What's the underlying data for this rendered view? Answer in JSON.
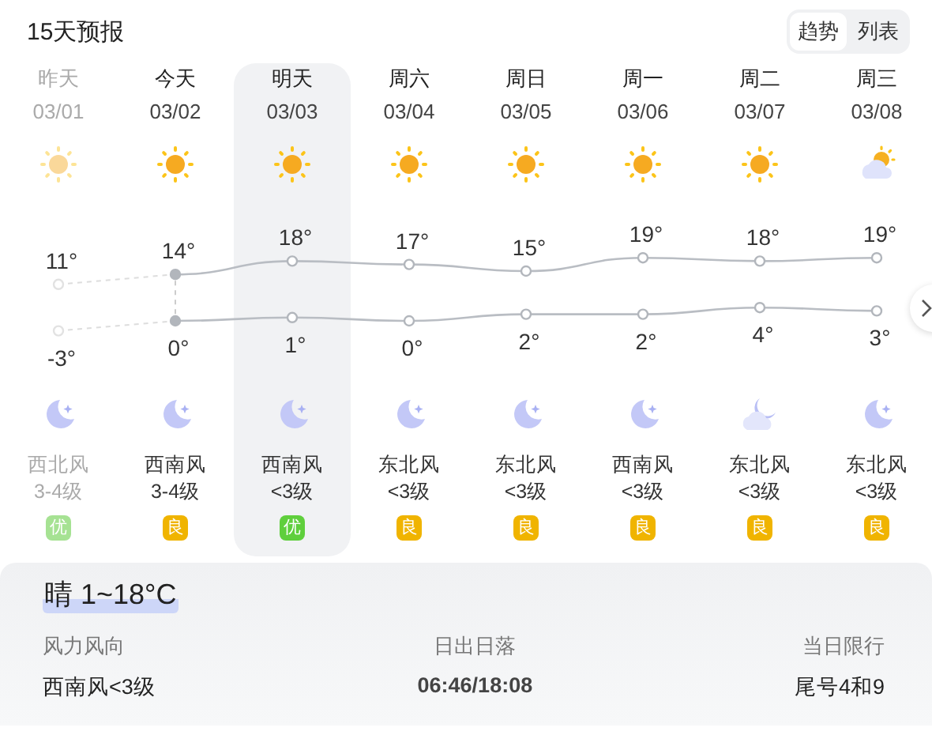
{
  "title": "15天预报",
  "view_toggle": [
    {
      "label": "趋势",
      "selected": true
    },
    {
      "label": "列表",
      "selected": false
    }
  ],
  "days": [
    {
      "name": "昨天",
      "date": "03/01",
      "day_icon": {
        "kind": "sun"
      },
      "high": "11°",
      "low": "-3°",
      "night_icon": {
        "kind": "moon"
      },
      "wind": "西北风",
      "wind_level": "3-4级",
      "aqi": "优",
      "color": "#a6e293",
      "past": true,
      "selected": false,
      "today": false
    },
    {
      "name": "今天",
      "date": "03/02",
      "day_icon": {
        "kind": "sun"
      },
      "high": "14°",
      "low": "0°",
      "night_icon": {
        "kind": "moon"
      },
      "wind": "西南风",
      "wind_level": "3-4级",
      "aqi": "良",
      "color": "#f0b400",
      "past": false,
      "selected": false,
      "today": true
    },
    {
      "name": "明天",
      "date": "03/03",
      "day_icon": {
        "kind": "sun"
      },
      "high": "18°",
      "low": "1°",
      "night_icon": {
        "kind": "moon"
      },
      "wind": "西南风",
      "wind_level": "<3级",
      "aqi": "优",
      "color": "#5fcf3c",
      "past": false,
      "selected": true,
      "today": false
    },
    {
      "name": "周六",
      "date": "03/04",
      "day_icon": {
        "kind": "sun"
      },
      "high": "17°",
      "low": "0°",
      "night_icon": {
        "kind": "moon"
      },
      "wind": "东北风",
      "wind_level": "<3级",
      "aqi": "良",
      "color": "#f0b400",
      "past": false,
      "selected": false,
      "today": false
    },
    {
      "name": "周日",
      "date": "03/05",
      "day_icon": {
        "kind": "sun"
      },
      "high": "15°",
      "low": "2°",
      "night_icon": {
        "kind": "moon"
      },
      "wind": "东北风",
      "wind_level": "<3级",
      "aqi": "良",
      "color": "#f0b400",
      "past": false,
      "selected": false,
      "today": false
    },
    {
      "name": "周一",
      "date": "03/06",
      "day_icon": {
        "kind": "sun"
      },
      "high": "19°",
      "low": "2°",
      "night_icon": {
        "kind": "moon"
      },
      "wind": "西南风",
      "wind_level": "<3级",
      "aqi": "良",
      "color": "#f0b400",
      "past": false,
      "selected": false,
      "today": false
    },
    {
      "name": "周二",
      "date": "03/07",
      "day_icon": {
        "kind": "sun"
      },
      "high": "18°",
      "low": "4°",
      "night_icon": {
        "kind": "cloud-moon"
      },
      "wind": "东北风",
      "wind_level": "<3级",
      "aqi": "良",
      "color": "#f0b400",
      "past": false,
      "selected": false,
      "today": false
    },
    {
      "name": "周三",
      "date": "03/08",
      "day_icon": {
        "kind": "sun-cloud"
      },
      "high": "19°",
      "low": "3°",
      "night_icon": {
        "kind": "moon"
      },
      "wind": "东北风",
      "wind_level": "<3级",
      "aqi": "良",
      "color": "#f0b400",
      "past": false,
      "selected": false,
      "today": false
    }
  ],
  "summary": {
    "condition": "晴 1~18°C",
    "details": [
      {
        "label": "风力风向",
        "value": "西南风<3级"
      },
      {
        "label": "日出日落",
        "value": "06:46/18:08"
      },
      {
        "label": "当日限行",
        "value": "尾号4和9"
      }
    ]
  }
}
